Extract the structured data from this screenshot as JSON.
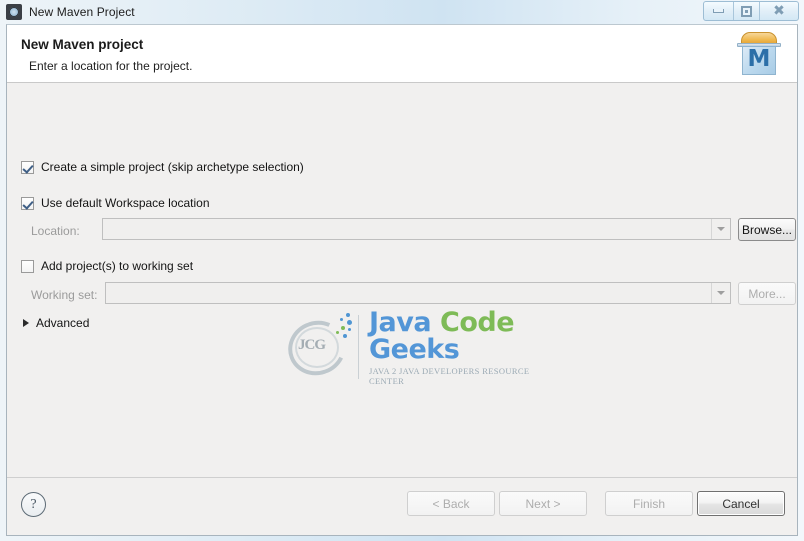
{
  "window": {
    "title": "New Maven Project",
    "app_icon": "maven-gear-icon",
    "controls": [
      {
        "name": "minimize",
        "glyph": "minimize-icon"
      },
      {
        "name": "restore",
        "glyph": "restore-icon"
      },
      {
        "name": "close",
        "glyph": "close-icon"
      }
    ]
  },
  "header": {
    "title": "New Maven project",
    "subtitle": "Enter a location for the project.",
    "banner_icon": "maven-project-icon",
    "banner_letter": "M"
  },
  "form": {
    "simple_project": {
      "label": "Create a simple project (skip archetype selection)",
      "checked": true
    },
    "default_location": {
      "label": "Use default Workspace location",
      "checked": true
    },
    "location": {
      "label": "Location:",
      "value": "",
      "placeholder": "",
      "enabled": false,
      "browse_label": "Browse...",
      "browse_enabled": true
    },
    "add_to_working_set": {
      "label": "Add project(s) to working set",
      "checked": false
    },
    "working_set": {
      "label": "Working set:",
      "value": "",
      "placeholder": "",
      "enabled": false,
      "more_label": "More...",
      "more_enabled": false
    },
    "advanced": {
      "label": "Advanced",
      "expanded": false
    }
  },
  "watermark": {
    "monogram": "JCG",
    "word1": "Java",
    "word2": "Code",
    "word3": "Geeks",
    "tagline": "Java 2 Java Developers Resource Center",
    "color_blue": "#3e8ad4",
    "color_green": "#6fb443"
  },
  "footer": {
    "help_label": "?",
    "buttons": [
      {
        "label": "< Back",
        "enabled": false,
        "default": false
      },
      {
        "label": "Next >",
        "enabled": false,
        "default": false
      },
      {
        "label": "Finish",
        "enabled": false,
        "default": false
      },
      {
        "label": "Cancel",
        "enabled": true,
        "default": true
      }
    ]
  }
}
